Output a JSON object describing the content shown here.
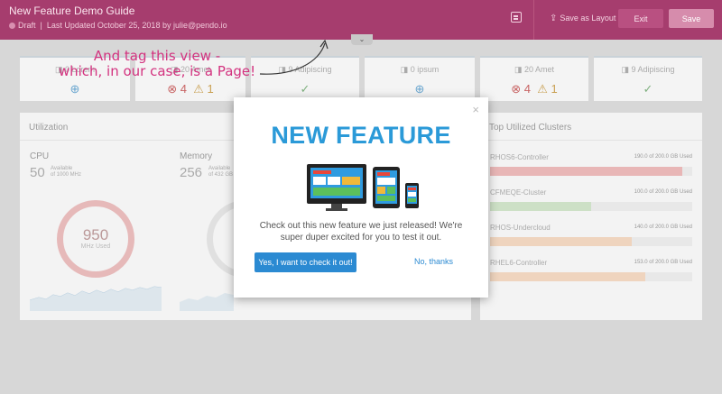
{
  "editor": {
    "title": "New Feature Demo Guide",
    "status": "Draft",
    "last_updated": "Last Updated October 25, 2018 by julie@pendo.io",
    "save_as_layout": "Save as Layout",
    "exit_label": "Exit",
    "save_label": "Save",
    "colors": {
      "bar": "#a63d6e",
      "accent": "#d3327f"
    }
  },
  "annotation": {
    "line1": "And tag this view -",
    "line2": "which, in our case, is a Page!"
  },
  "stats": [
    {
      "label": "0 Lorem",
      "icon": "check-icon"
    },
    {
      "label": "20 Amet",
      "err": "4",
      "warn": "1"
    },
    {
      "label": "9 Adipiscing",
      "icon": "check-icon"
    },
    {
      "label": "0 ipsum",
      "icon": "info-icon"
    },
    {
      "label": "20 Amet",
      "err": "4",
      "warn": "1"
    },
    {
      "label": "9 Adipiscing",
      "icon": "check-icon"
    }
  ],
  "utilization": {
    "title": "Utilization",
    "cpu": {
      "name": "CPU",
      "value": "50",
      "sub1": "Available",
      "sub2": "of 1000 MHz",
      "donut_value": "950",
      "donut_label": "MHz Used"
    },
    "memory": {
      "name": "Memory",
      "value": "256",
      "sub1": "Available",
      "sub2": "of 432 GB"
    }
  },
  "clusters": {
    "title": "Top Utilized Clusters",
    "items": [
      {
        "name": "RHOS6-Controller",
        "used": "190.0 of 200.0 GB Used",
        "pct": 95,
        "color": "#e8b6b6"
      },
      {
        "name": "CFMEQE-Cluster",
        "used": "100.0 of 200.0 GB Used",
        "pct": 50,
        "color": "#cde0c6"
      },
      {
        "name": "RHOS-Undercloud",
        "used": "140.0 of 200.0 GB Used",
        "pct": 70,
        "color": "#efd4be"
      },
      {
        "name": "RHEL6-Controller",
        "used": "153.0 of 200.0 GB Used",
        "pct": 77,
        "color": "#efd4be"
      }
    ]
  },
  "modal": {
    "close": "×",
    "headline": "NEW FEATURE",
    "body": "Check out this new feature we just released! We're super duper excited for you to test it out.",
    "primary": "Yes, I want to check it out!",
    "secondary": "No, thanks"
  }
}
